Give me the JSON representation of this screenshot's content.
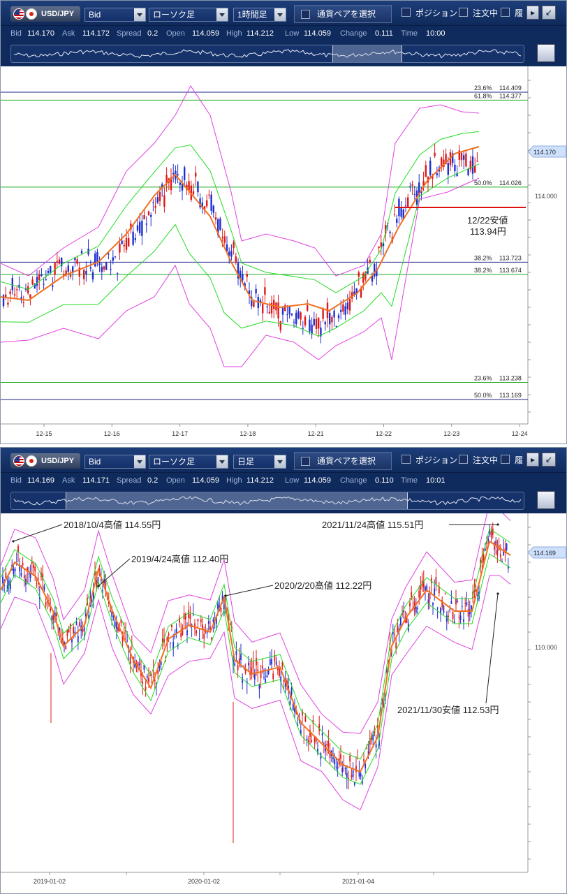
{
  "panels": [
    {
      "pair": "USD/JPY",
      "price_type": "Bid",
      "chart_type": "ローソク足",
      "timeframe": "1時間足",
      "pair_select_label": "通貨ペアを選択",
      "checkboxes": [
        "ポジション",
        "注文中",
        "履"
      ],
      "quote": {
        "bid_label": "Bid",
        "bid": "114.170",
        "ask_label": "Ask",
        "ask": "114.172",
        "spread_label": "Spread",
        "spread": "0.2",
        "open_label": "Open",
        "open": "114.059",
        "high_label": "High",
        "high": "114.212",
        "low_label": "Low",
        "low": "114.059",
        "change_label": "Change",
        "change": "0.111",
        "time_label": "Time",
        "time": "10:00"
      },
      "current_price": "114.170",
      "y_tick": "114.000",
      "x_ticks": [
        "12-15",
        "12-16",
        "12-17",
        "12-18",
        "12-21",
        "12-22",
        "12-23",
        "12-24"
      ],
      "fib_lines": [
        {
          "label": "23.6%",
          "value": "114.409",
          "color": "#20208a"
        },
        {
          "label": "61.8%",
          "value": "114.377",
          "color": "#22aa22"
        },
        {
          "label": "50.0%",
          "value": "114.026",
          "color": "#22aa22"
        },
        {
          "label": "38.2%",
          "value": "113.723",
          "color": "#20208a"
        },
        {
          "label": "38.2%",
          "value": "113.674",
          "color": "#22aa22"
        },
        {
          "label": "23.6%",
          "value": "113.238",
          "color": "#22aa22"
        },
        {
          "label": "50.0%",
          "value": "113.169",
          "color": "#20208a"
        }
      ],
      "annotations": [
        "12/22安値",
        "113.94円"
      ]
    },
    {
      "pair": "USD/JPY",
      "price_type": "Bid",
      "chart_type": "ローソク足",
      "timeframe": "日足",
      "pair_select_label": "通貨ペアを選択",
      "checkboxes": [
        "ポジション",
        "注文中",
        "履"
      ],
      "quote": {
        "bid_label": "Bid",
        "bid": "114.169",
        "ask_label": "Ask",
        "ask": "114.171",
        "spread_label": "Spread",
        "spread": "0.2",
        "open_label": "Open",
        "open": "114.059",
        "high_label": "High",
        "high": "114.212",
        "low_label": "Low",
        "low": "114.059",
        "change_label": "Change",
        "change": "0.110",
        "time_label": "Time",
        "time": "10:01"
      },
      "current_price": "114.169",
      "y_tick": "110.000",
      "x_ticks": [
        "2019-01-02",
        "2020-01-02",
        "2021-01-04"
      ],
      "annotations": [
        "2018/10/4高値 114.55円",
        "2019/4/24高値 112.40円",
        "2020/2/20高値 112.22円",
        "2021/11/24高値 115.51円",
        "2021/11/30安値 112.53円"
      ]
    }
  ],
  "colors": {
    "bull": "#1f2fd0",
    "bear": "#e01818",
    "ma": "#f07020",
    "bb_inner": "#22dd22",
    "bb_outer": "#e040e0",
    "grid": "#dddddd"
  }
}
